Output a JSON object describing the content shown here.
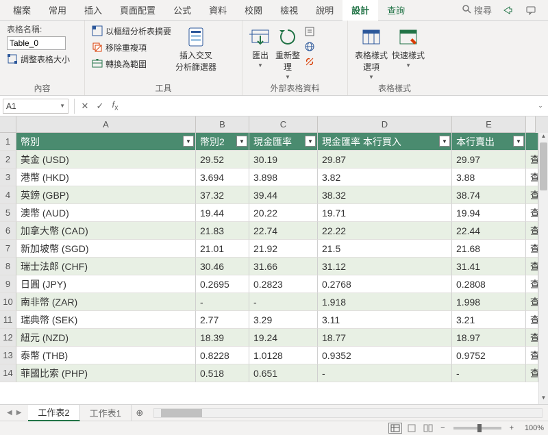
{
  "ribbon": {
    "tabs": [
      "檔案",
      "常用",
      "插入",
      "頁面配置",
      "公式",
      "資料",
      "校閱",
      "檢視",
      "說明",
      "設計",
      "查詢"
    ],
    "active_index": 9,
    "search_placeholder": "搜尋",
    "groups": {
      "content_label": "內容",
      "tools_label": "工具",
      "external_label": "外部表格資料",
      "styles_label": "表格樣式",
      "table_name_label": "表格名稱:",
      "table_name_value": "Table_0",
      "resize_table": "調整表格大小",
      "pivot_summary": "以樞紐分析表摘要",
      "remove_dupes": "移除重複項",
      "convert_range": "轉換為範圍",
      "insert_slicer": "插入交叉\n分析篩選器",
      "export": "匯出",
      "refresh": "重新整\n理",
      "table_style_options": "表格樣式\n選項",
      "quick_styles": "快速樣式"
    }
  },
  "namebox": "A1",
  "columns": [
    "A",
    "B",
    "C",
    "D",
    "E"
  ],
  "col_classes": [
    "colA",
    "colB",
    "colC",
    "colD",
    "colE",
    "colF"
  ],
  "headers": [
    "幣別",
    "幣別2",
    "現金匯率",
    "現金匯率 本行買入",
    "本行賣出",
    ""
  ],
  "chart_data": {
    "type": "table",
    "columns": [
      "幣別",
      "幣別2",
      "現金匯率",
      "現金匯率 本行買入",
      "本行賣出"
    ],
    "rows": [
      [
        "美金 (USD)",
        "29.52",
        "30.19",
        "29.87",
        "29.97"
      ],
      [
        "港幣 (HKD)",
        "3.694",
        "3.898",
        "3.82",
        "3.88"
      ],
      [
        "英鎊 (GBP)",
        "37.32",
        "39.44",
        "38.32",
        "38.74"
      ],
      [
        "澳幣 (AUD)",
        "19.44",
        "20.22",
        "19.71",
        "19.94"
      ],
      [
        "加拿大幣 (CAD)",
        "21.83",
        "22.74",
        "22.22",
        "22.44"
      ],
      [
        "新加坡幣 (SGD)",
        "21.01",
        "21.92",
        "21.5",
        "21.68"
      ],
      [
        "瑞士法郎 (CHF)",
        "30.46",
        "31.66",
        "31.12",
        "31.41"
      ],
      [
        "日圓 (JPY)",
        "0.2695",
        "0.2823",
        "0.2768",
        "0.2808"
      ],
      [
        "南非幣 (ZAR)",
        "-",
        "-",
        "1.918",
        "1.998"
      ],
      [
        "瑞典幣 (SEK)",
        "2.77",
        "3.29",
        "3.11",
        "3.21"
      ],
      [
        "紐元 (NZD)",
        "18.39",
        "19.24",
        "18.77",
        "18.97"
      ],
      [
        "泰幣 (THB)",
        "0.8228",
        "1.0128",
        "0.9352",
        "0.9752"
      ],
      [
        "菲國比索 (PHP)",
        "0.518",
        "0.651",
        "-",
        "-"
      ]
    ]
  },
  "last_col_char": "查",
  "sheets": {
    "active": "工作表2",
    "others": [
      "工作表1"
    ]
  },
  "zoom": "100%"
}
